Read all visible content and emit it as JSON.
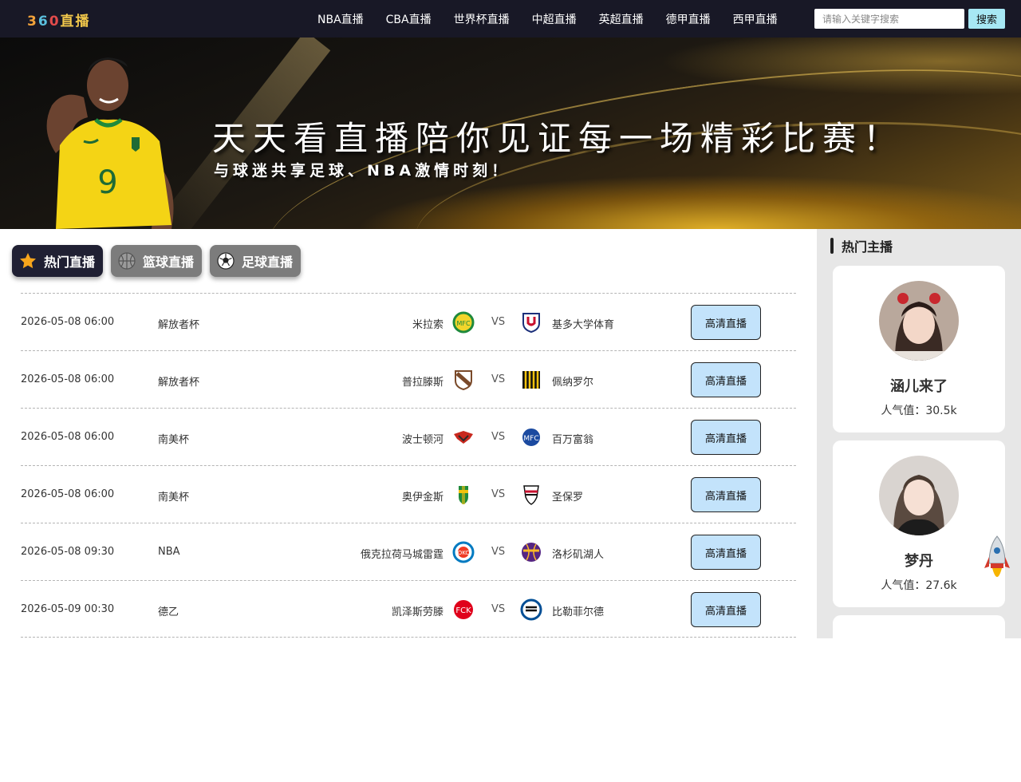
{
  "header": {
    "logo_digits": [
      "3",
      "6",
      "0"
    ],
    "logo_text": "直播",
    "nav": [
      "NBA直播",
      "CBA直播",
      "世界杯直播",
      "中超直播",
      "英超直播",
      "德甲直播",
      "西甲直播"
    ],
    "search_placeholder": "请输入关键字搜索",
    "search_button": "搜索"
  },
  "banner": {
    "slogan": "天天看直播陪你见证每一场精彩比赛！",
    "sub_slogan": "与球迷共享足球、NBA激情时刻！",
    "jersey_number": "9"
  },
  "tabs": [
    {
      "label": "热门直播",
      "icon": "star-icon",
      "active": true
    },
    {
      "label": "篮球直播",
      "icon": "basketball-icon",
      "active": false
    },
    {
      "label": "足球直播",
      "icon": "soccer-ball-icon",
      "active": false
    }
  ],
  "matches": [
    {
      "time": "2026-05-08 06:00",
      "league": "解放者杯",
      "home": "米拉索",
      "away": "基多大学体育",
      "vs": "VS",
      "button": "高清直播",
      "home_logo": "mirassol-crest",
      "away_logo": "ldu-quito-crest"
    },
    {
      "time": "2026-05-08 06:00",
      "league": "解放者杯",
      "home": "普拉滕斯",
      "away": "佩纳罗尔",
      "vs": "VS",
      "button": "高清直播",
      "home_logo": "platense-crest",
      "away_logo": "penarol-crest"
    },
    {
      "time": "2026-05-08 06:00",
      "league": "南美杯",
      "home": "波士顿河",
      "away": "百万富翁",
      "vs": "VS",
      "button": "高清直播",
      "home_logo": "boston-river-crest",
      "away_logo": "millonarios-crest"
    },
    {
      "time": "2026-05-08 06:00",
      "league": "南美杯",
      "home": "奥伊金斯",
      "away": "圣保罗",
      "vs": "VS",
      "button": "高清直播",
      "home_logo": "ohiggins-crest",
      "away_logo": "sao-paulo-crest"
    },
    {
      "time": "2026-05-08 09:30",
      "league": "NBA",
      "home": "俄克拉荷马城雷霆",
      "away": "洛杉矶湖人",
      "vs": "VS",
      "button": "高清直播",
      "home_logo": "okc-thunder-logo",
      "away_logo": "lakers-logo"
    },
    {
      "time": "2026-05-09 00:30",
      "league": "德乙",
      "home": "凯泽斯劳滕",
      "away": "比勒菲尔德",
      "vs": "VS",
      "button": "高清直播",
      "home_logo": "kaiserslautern-crest",
      "away_logo": "bielefeld-crest"
    }
  ],
  "sidebar": {
    "title": "热门主播",
    "streamers": [
      {
        "name": "涵儿来了",
        "popularity": "人气值：30.5k"
      },
      {
        "name": "梦丹",
        "popularity": "人气值：27.6k"
      }
    ]
  },
  "colors": {
    "header_bg": "#181826",
    "button_bg": "#c3e3fb",
    "search_btn_bg": "#a7e8f4",
    "tab_active": "#202033",
    "tab_inactive": "#7c7c7c",
    "sidebar_bg": "#e7e7e7"
  }
}
